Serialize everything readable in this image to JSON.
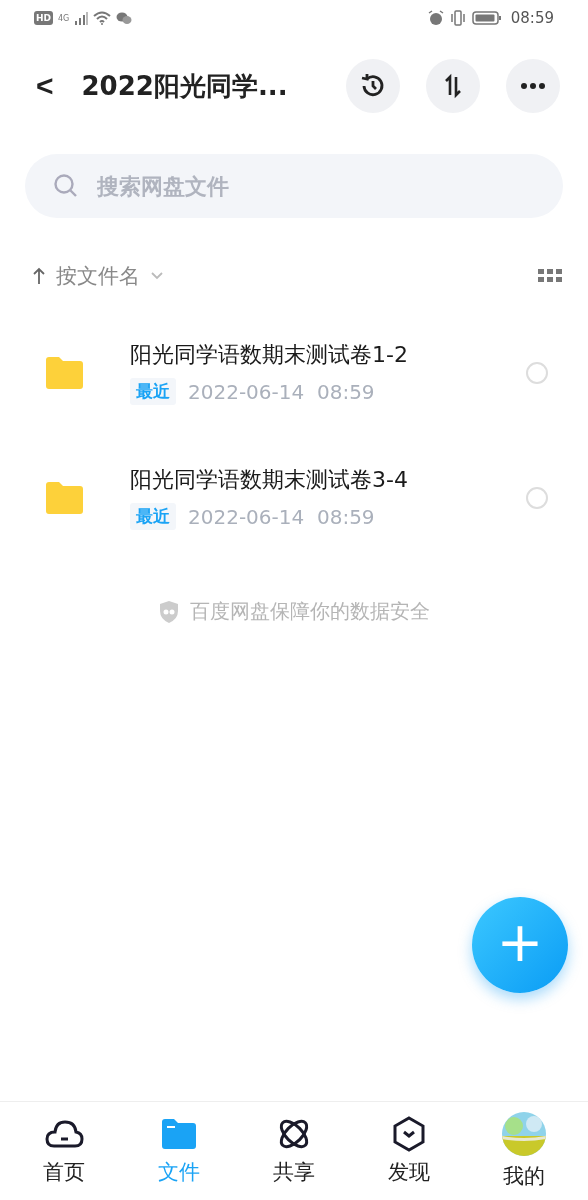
{
  "status_bar": {
    "hd": "HD",
    "network": "4G",
    "time": "08:59"
  },
  "header": {
    "back": "<",
    "title": "2022阳光同学..."
  },
  "search": {
    "placeholder": "搜索网盘文件"
  },
  "sort": {
    "label": "按文件名"
  },
  "files": [
    {
      "name": "阳光同学语数期末测试卷1-2",
      "tag": "最近",
      "date": "2022-06-14  08:59",
      "checked": false
    },
    {
      "name": "阳光同学语数期末测试卷3-4",
      "tag": "最近",
      "date": "2022-06-14  08:59",
      "checked": false
    }
  ],
  "footer_note": "百度网盘保障你的数据安全",
  "fab": "+",
  "tabs": [
    {
      "label": "首页",
      "kind": "cloud",
      "selected": false
    },
    {
      "label": "文件",
      "kind": "folder",
      "selected": true
    },
    {
      "label": "共享",
      "kind": "orbit",
      "selected": false
    },
    {
      "label": "发现",
      "kind": "hexagon",
      "selected": false
    },
    {
      "label": "我的",
      "kind": "avatar",
      "selected": false
    }
  ]
}
